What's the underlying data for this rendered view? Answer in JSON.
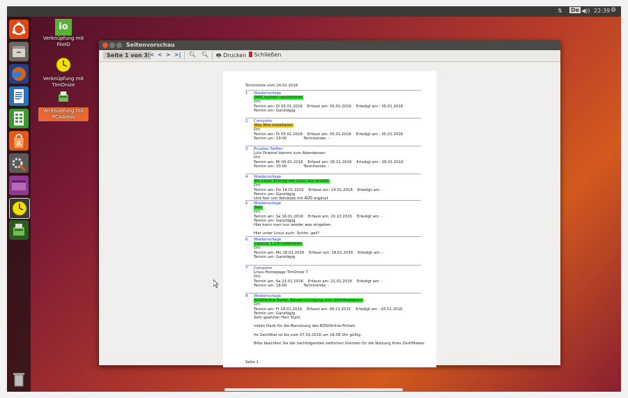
{
  "topbar": {
    "keyboard_layout": "De",
    "clock": "22:39"
  },
  "launcher": {
    "items": [
      {
        "name": "ubuntu-dash-icon",
        "color": "#dd4814"
      },
      {
        "name": "files-icon",
        "color": "#8a8580"
      },
      {
        "name": "firefox-icon",
        "color": "#e66000"
      },
      {
        "name": "writer-icon",
        "color": "#2e6fb6"
      },
      {
        "name": "calc-icon",
        "color": "#3d9a32"
      },
      {
        "name": "software-center-icon",
        "color": "#e05a1a"
      },
      {
        "name": "settings-icon",
        "color": "#7a7a7a"
      },
      {
        "name": "video-icon",
        "color": "#8e3a8e"
      },
      {
        "name": "timonize-icon",
        "color": "#f3e000"
      },
      {
        "name": "pcadress-icon",
        "color": "#3d7a2e"
      }
    ]
  },
  "desktop_icons": [
    {
      "label": "Verknüpfung mit FileIO",
      "glyph": "io"
    },
    {
      "label": "Verknüpfung mit TimOnize"
    },
    {
      "label": "Verknüpfung mit PCAdress"
    }
  ],
  "window": {
    "title": "Seitenvorschau",
    "toolbar": {
      "page_indicator": "Seite 1 von 3",
      "first": "|<",
      "prev": "<",
      "next": ">",
      "last": ">|",
      "print": "Drucken",
      "close": "Schließen"
    }
  },
  "document": {
    "header": "Terminliste vom 24.01.2016",
    "footer": "Seite 1",
    "entries": [
      {
        "num": "1",
        "category": "Wiedervorlage",
        "title": "DMC kuchen rausnehmen",
        "highlight": "#22e822",
        "lines": [
          "Ort:",
          "Termin am: Di 05.01.2016    Erfasst am: 05.01.2016    Erledigt am : 05.01.2016",
          "Termin um: Ganztägig"
        ]
      },
      {
        "num": "2",
        "category": "Computer",
        "title": "Mac Mini installieren",
        "highlight": "#f0c419",
        "lines": [
          "Ort:",
          "Termin am: Di 05.01.2016    Erfasst am: 05.01.2016    Erledigt am : 05.01.2016",
          "Termin um: 19:00              Terminende: -"
        ]
      },
      {
        "num": "3",
        "category": "Privates Treffen",
        "title": "Lutz Driemel kommt zum Abendessen",
        "highlight": "",
        "lines": [
          "Ort:",
          "Termin am: Mi 06.01.2016    Erfasst am: 05.01.2016    Erledigt am : 06.01.2016",
          "Termin um: 20:00              Terminende: -"
        ]
      },
      {
        "num": "4",
        "category": "Wiedervorlage",
        "title": "Ein neuer Eintrag von Linux aus erstellt",
        "highlight": "#22e822",
        "lines": [
          "Ort:",
          "Termin am: Do 14.01.2016    Erfasst am: 14.01.2016    Erledigt am: -",
          "Termin um: Ganztägig",
          "Und hier von Windows mit ÄÜÖ ergänzt"
        ]
      },
      {
        "num": "5",
        "category": "Wiedervorlage",
        "title": "Test",
        "highlight": "#22e822",
        "lines": [
          "Ort:",
          "Termin am: Sa 16.01.2016    Erfasst am: 20.10.2015    Erledigt am: -",
          "Termin um: Ganztägig",
          "Hier kann man nun wieder was eingeben.",
          " ",
          "Hier unter Linux auch. Schön, geil?"
        ]
      },
      {
        "num": "6",
        "category": "Wiedervorlage",
        "title": "Lazarus 1.2.6 installieren",
        "highlight": "#22e822",
        "lines": [
          "Ort:",
          "Termin am: Mo 18.01.2016    Erfasst am: 18.01.2016    Erledigt am: -",
          "Termin um: Ganztägig"
        ]
      },
      {
        "num": "7",
        "category": "Computer",
        "title": "Linux-Homepage TimOnize 7",
        "highlight": "",
        "lines": [
          "Ort:",
          "Termin am: Sa 23.01.2016    Erfasst am: 21.01.2016    Erledigt am: -",
          "Termin um: 18:00              Terminende: -"
        ]
      },
      {
        "num": "8",
        "category": "Wiedervorlage",
        "title": "BZStOnline-Portal: Benachrichtigung zum Zertifikatablauf",
        "highlight": "#22e822",
        "lines": [
          "Ort:",
          "Termin am: Fr 29.01.2016    Erfasst am: 09.11.2015    Erledigt am : 03.01.2016",
          "Termin um: Ganztägig",
          "Sehr geehrter Herr Stahl,",
          " ",
          "vielen Dank für die Benutzung des BZStOnline-Portals.",
          " ",
          "Ihr Zertifikat ist bis zum 07.02.2016 um 16:58 Uhr gültig.",
          " ",
          "Bitte beachten Sie die nachfolgenden zeitlichen Grenzen für die Nutzung Ihres Zertifikates:"
        ]
      }
    ]
  }
}
